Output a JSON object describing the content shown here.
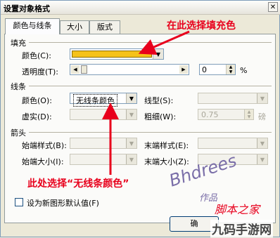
{
  "window": {
    "title": "设置对象格式",
    "close": "✕"
  },
  "tabs": [
    {
      "label": "颜色与线条"
    },
    {
      "label": "大小"
    },
    {
      "label": "版式"
    }
  ],
  "fill": {
    "section": "填充",
    "color_label": "颜色(C):",
    "color_value": "#f5c21a",
    "transparency_label": "透明度(T):",
    "transparency_value": "0",
    "percent": "%"
  },
  "line": {
    "section": "线条",
    "color_label": "颜色(O):",
    "color_value": "无线条颜色",
    "dash_label": "虚实(D):",
    "style_label": "线型(S):",
    "weight_label": "粗细(W):",
    "weight_value": "0.75",
    "weight_unit": "磅"
  },
  "arrows": {
    "section": "箭头",
    "begin_style_label": "始端样式(B):",
    "end_style_label": "末端样式(E):",
    "begin_size_label": "始端大小(I):",
    "end_size_label": "末端大小(Z):"
  },
  "default_checkbox": {
    "label": "设为新图形默认值(F)"
  },
  "ok_button": {
    "label": "确"
  },
  "annotations": {
    "fill_hint": "在此选择填充色",
    "line_hint": "此处选择“无线条颜色”"
  },
  "watermarks": {
    "handwriting": "Bhdrees",
    "sub": "作品",
    "site": "脚本之家",
    "brand": "九码手游网"
  },
  "colors": {
    "accent": "#e8001c",
    "fill": "#f5c21a"
  }
}
